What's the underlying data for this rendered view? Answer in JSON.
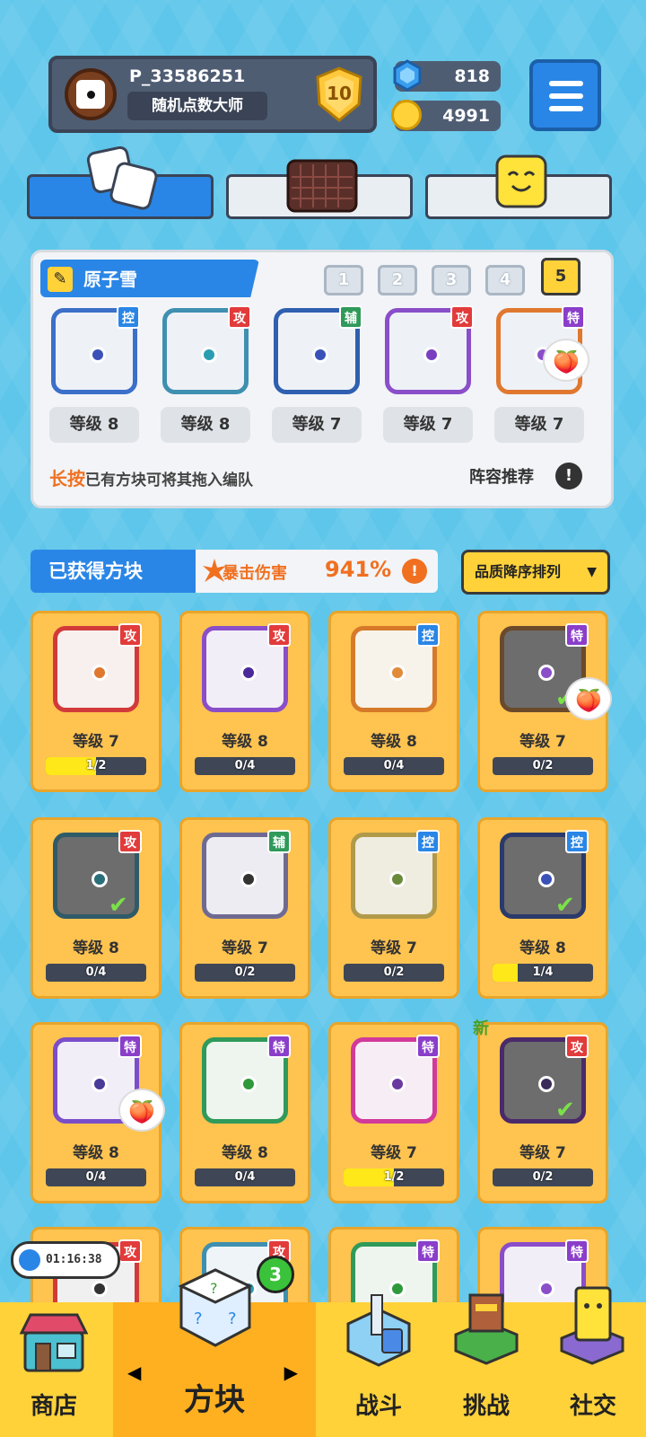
{
  "player": {
    "name": "P_33586251",
    "title": "随机点数大师",
    "rank": "10"
  },
  "currency": {
    "gems": "818",
    "coins": "4991"
  },
  "deck": {
    "name": "原子雪",
    "slots": [
      "1",
      "2",
      "3",
      "4",
      "5"
    ],
    "active_slot": "5",
    "dice": [
      {
        "level": "等级 8",
        "tag": "控",
        "tag_color": "#2a86e6",
        "border": "#3b6fc9",
        "pip": "#3a52b8"
      },
      {
        "level": "等级 8",
        "tag": "攻",
        "tag_color": "#e23b3b",
        "border": "#3f8fb0",
        "pip": "#2a9eb0"
      },
      {
        "level": "等级 7",
        "tag": "辅",
        "tag_color": "#2f9a5a",
        "border": "#2f5fb0",
        "pip": "#3a52b8"
      },
      {
        "level": "等级 7",
        "tag": "攻",
        "tag_color": "#e23b3b",
        "border": "#8a4ec9",
        "pip": "#7a3ec0"
      },
      {
        "level": "等级 7",
        "tag": "特",
        "tag_color": "#8a3ec9",
        "border": "#e07830",
        "pip": "#8a4ec9"
      }
    ],
    "hint_highlight": "长按",
    "hint_text": "已有方块可将其拖入编队",
    "recommend_label": "阵容推荐",
    "info_symbol": "!"
  },
  "owned": {
    "label": "已获得方块",
    "crit_label": "暴击伤害",
    "crit_value": "941%",
    "crit_info": "!",
    "sort_label": "品质降序排列"
  },
  "cards": [
    {
      "level": "等级 7",
      "progress": "1/2",
      "fill": 0.5,
      "tag": "攻",
      "tag_color": "#e23b3b",
      "border": "#d23a3a",
      "pip": "#e07830",
      "bg": "#f7f0ee"
    },
    {
      "level": "等级 8",
      "progress": "0/4",
      "fill": 0,
      "tag": "攻",
      "tag_color": "#e23b3b",
      "border": "#8a4ec9",
      "pip": "#4a2a9a",
      "bg": "#f2eef7"
    },
    {
      "level": "等级 8",
      "progress": "0/4",
      "fill": 0,
      "tag": "控",
      "tag_color": "#2a86e6",
      "border": "#d67a2a",
      "pip": "#e08a3a",
      "bg": "#f7f2ea"
    },
    {
      "level": "等级 7",
      "progress": "0/2",
      "fill": 0,
      "tag": "特",
      "tag_color": "#8a3ec9",
      "border": "#6a4a2a",
      "pip": "#8a4ec9",
      "bg": "#6d6d6d",
      "checked": true,
      "peach": true
    },
    {
      "level": "等级 8",
      "progress": "0/4",
      "fill": 0,
      "tag": "攻",
      "tag_color": "#e23b3b",
      "border": "#2f5a68",
      "pip": "#2a6e7a",
      "bg": "#6d6d6d",
      "checked": true
    },
    {
      "level": "等级 7",
      "progress": "0/2",
      "fill": 0,
      "tag": "辅",
      "tag_color": "#2f9a5a",
      "border": "#6f6a92",
      "pip": "#333333",
      "bg": "#ececf2"
    },
    {
      "level": "等级 7",
      "progress": "0/2",
      "fill": 0,
      "tag": "控",
      "tag_color": "#2a86e6",
      "border": "#b09a4a",
      "pip": "#6a8a3a",
      "bg": "#efece0"
    },
    {
      "level": "等级 8",
      "progress": "1/4",
      "fill": 0.25,
      "tag": "控",
      "tag_color": "#2a86e6",
      "border": "#2a3a6a",
      "pip": "#3a52b8",
      "bg": "#6d6d6d",
      "checked": true
    },
    {
      "level": "等级 8",
      "progress": "0/4",
      "fill": 0,
      "tag": "特",
      "tag_color": "#8a3ec9",
      "border": "#7a4ec9",
      "pip": "#4a3a9a",
      "bg": "#f2eef7",
      "peach": true
    },
    {
      "level": "等级 8",
      "progress": "0/4",
      "fill": 0,
      "tag": "特",
      "tag_color": "#8a3ec9",
      "border": "#2f9a5a",
      "pip": "#2f9a3a",
      "bg": "#eef5ee"
    },
    {
      "level": "等级 7",
      "progress": "1/2",
      "fill": 0.5,
      "tag": "特",
      "tag_color": "#8a3ec9",
      "border": "#d23a9a",
      "pip": "#6a3aa0",
      "bg": "#f7eef5"
    },
    {
      "level": "等级 7",
      "progress": "0/2",
      "fill": 0,
      "tag": "攻",
      "tag_color": "#e23b3b",
      "border": "#4a2a6a",
      "pip": "#3a2a5a",
      "bg": "#6d6d6d",
      "checked": true,
      "new": "新"
    },
    {
      "level": "",
      "progress": "",
      "fill": 0,
      "tag": "攻",
      "tag_color": "#e23b3b",
      "border": "#d23a3a",
      "pip": "#333333",
      "bg": "#f0f0f0"
    },
    {
      "level": "",
      "progress": "",
      "fill": 0,
      "tag": "攻",
      "tag_color": "#e23b3b",
      "border": "#3f8fb0",
      "pip": "#2a9eb0",
      "bg": "#eef4f7"
    },
    {
      "level": "",
      "progress": "",
      "fill": 0,
      "tag": "特",
      "tag_color": "#8a3ec9",
      "border": "#2f9a5a",
      "pip": "#2f9a3a",
      "bg": "#eef5ee"
    },
    {
      "level": "",
      "progress": "",
      "fill": 0,
      "tag": "特",
      "tag_color": "#8a3ec9",
      "border": "#8a4ec9",
      "pip": "#8a4ec9",
      "bg": "#f2eef7"
    }
  ],
  "check_mark": "✔",
  "peach_emoji": "🍑",
  "timer": "01:16:38",
  "nav": {
    "shop": "商店",
    "dice": "方块",
    "battle": "战斗",
    "challenge": "挑战",
    "social": "社交",
    "dice_badge": "3",
    "prev_arrow": "◀",
    "next_arrow": "▶"
  }
}
